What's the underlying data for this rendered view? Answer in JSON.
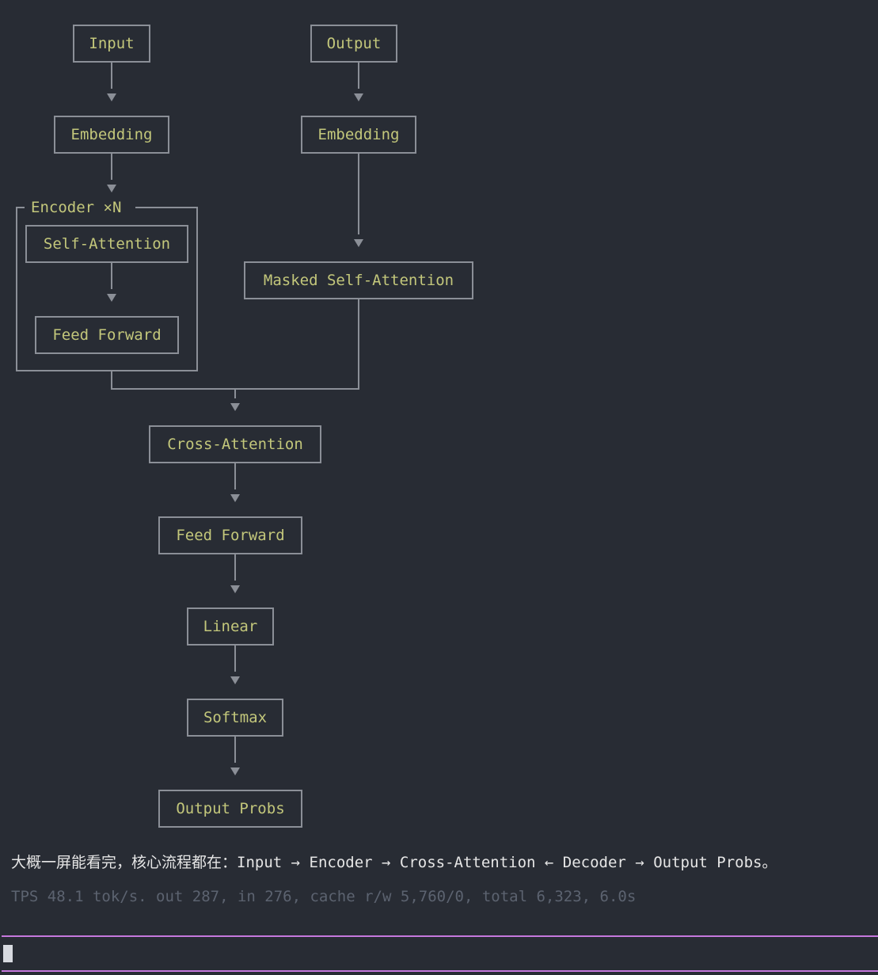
{
  "diagram": {
    "nodes": {
      "input": "Input",
      "output": "Output",
      "embedding_left": "Embedding",
      "embedding_right": "Embedding",
      "encoder_group": "Encoder ×N",
      "self_attention": "Self-Attention",
      "encoder_feed_forward": "Feed Forward",
      "masked_self_attention": "Masked Self-Attention",
      "cross_attention": "Cross-Attention",
      "feed_forward": "Feed Forward",
      "linear": "Linear",
      "softmax": "Softmax",
      "output_probs": "Output Probs"
    }
  },
  "summary_text": "大概一屏能看完，核心流程都在：Input → Encoder → Cross-Attention ← Decoder → Output Probs。",
  "stats_text": "TPS 48.1 tok/s. out 287, in 276, cache r/w 5,760/0, total 6,323, 6.0s",
  "colors": {
    "background": "#282c34",
    "node_text": "#c3c77b",
    "line": "#8b8f97",
    "summary_text": "#e6e6e6",
    "stats_text": "#5c6370",
    "input_border": "#c678dd"
  }
}
